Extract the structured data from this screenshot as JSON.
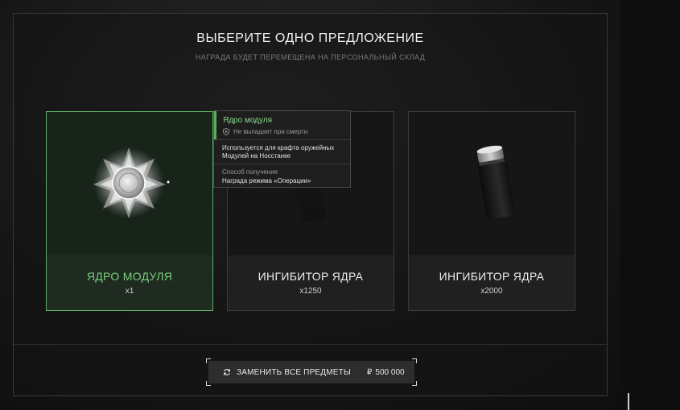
{
  "header": {
    "title": "ВЫБЕРИТЕ ОДНО ПРЕДЛОЖЕНИЕ",
    "subtitle": "НАГРАДА БУДЕТ ПЕРЕМЕЩЕНА НА ПЕРСОНАЛЬНЫЙ СКЛАД"
  },
  "offers": [
    {
      "name": "ЯДРО МОДУЛЯ",
      "qty": "x1",
      "selected": true,
      "icon": "module-core-crystal-icon"
    },
    {
      "name": "ИНГИБИТОР ЯДРА",
      "qty": "x1250",
      "selected": false,
      "icon": "core-inhibitor-canister-icon"
    },
    {
      "name": "ИНГИБИТОР ЯДРА",
      "qty": "x2000",
      "selected": false,
      "icon": "core-inhibitor-canister-icon"
    }
  ],
  "tooltip": {
    "title": "Ядро модуля",
    "death_note": "Не выпадает при смерти",
    "description": "Используется для крафта оружейных Модулей на Носстанке",
    "how_label": "Способ получения",
    "source": "Награда режима «Операции»"
  },
  "replace": {
    "label": "ЗАМЕНИТЬ ВСЕ ПРЕДМЕТЫ",
    "currency": "₽",
    "price": "500 000"
  },
  "colors": {
    "accent_green": "#7ad07d",
    "selected_border": "#5fae63",
    "panel_border": "#3a3a3a"
  }
}
